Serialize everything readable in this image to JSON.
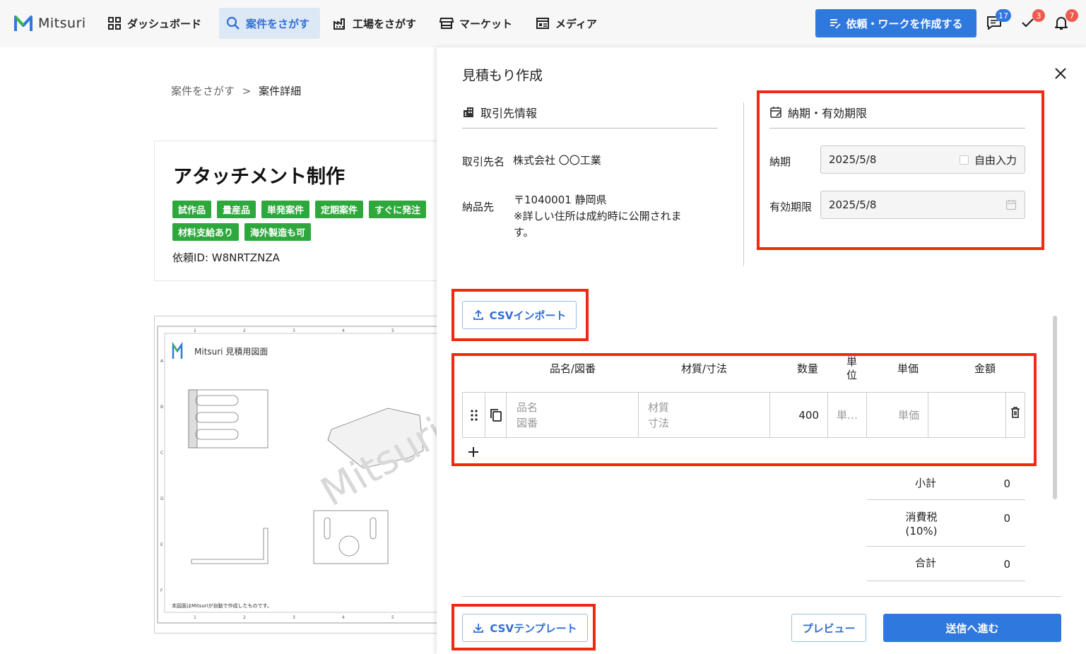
{
  "nav": {
    "logo_text": "Mitsuri",
    "items": [
      {
        "label": "ダッシュボード",
        "icon": "grid-icon"
      },
      {
        "label": "案件をさがす",
        "icon": "search-icon",
        "active": true
      },
      {
        "label": "工場をさがす",
        "icon": "factory-icon"
      },
      {
        "label": "マーケット",
        "icon": "store-icon"
      },
      {
        "label": "メディア",
        "icon": "media-icon"
      }
    ],
    "create_label": "依頼・ワークを作成する",
    "messages_count": "17",
    "tasks_count": "3",
    "notifications_count": "7",
    "colors": {
      "accent": "#2f78dd",
      "badge_blue": "#2f78dd",
      "badge_red": "#ef5a4f"
    }
  },
  "page": {
    "breadcrumb": {
      "parent": "案件をさがす",
      "separator": ">",
      "current": "案件詳細"
    },
    "title": "アタッチメント制作",
    "tags": [
      "試作品",
      "量産品",
      "単発案件",
      "定期案件",
      "すぐに発注",
      "材料支給あり",
      "海外製造も可"
    ],
    "request_id": "依頼ID: W8NRTZNZA",
    "drawing": {
      "header": "Mitsuri 見積用図面",
      "watermark": "Mitsuri",
      "footnote": "本図面はMitsuriが自動で作成したものです。"
    }
  },
  "modal": {
    "title": "見積もり作成",
    "client": {
      "heading": "取引先情報",
      "name_label": "取引先名",
      "name_value": "株式会社 〇〇工業",
      "delivery_label": "納品先",
      "delivery_line1": "〒1040001 静岡県",
      "delivery_line2": "※詳しい住所は成約時に公開されま",
      "delivery_line3": "す。"
    },
    "deadline": {
      "heading": "納期・有効期限",
      "due_label": "納期",
      "due_value": "2025/5/8",
      "free_input_label": "自由入力",
      "expiry_label": "有効期限",
      "expiry_value": "2025/5/8"
    },
    "csv_import_label": "CSVインポート",
    "table": {
      "headers": {
        "item": "品名/図番",
        "material": "材質/寸法",
        "qty": "数量",
        "unit_1": "単",
        "unit_2": "位",
        "price": "単価",
        "amount": "金額"
      },
      "row": {
        "item_ph_1": "品名",
        "item_ph_2": "図番",
        "material_ph_1": "材質",
        "material_ph_2": "寸法",
        "qty": "400",
        "unit_ph": "単…",
        "price_ph": "単価",
        "amount": ""
      }
    },
    "summary": {
      "subtotal_label": "小計",
      "subtotal_value": "0",
      "tax_label_1": "消費税",
      "tax_label_2": "(10%)",
      "tax_value": "0",
      "total_label": "合計",
      "total_value": "0"
    },
    "csv_template_label": "CSVテンプレート",
    "preview_label": "プレビュー",
    "submit_label": "送信へ進む"
  }
}
